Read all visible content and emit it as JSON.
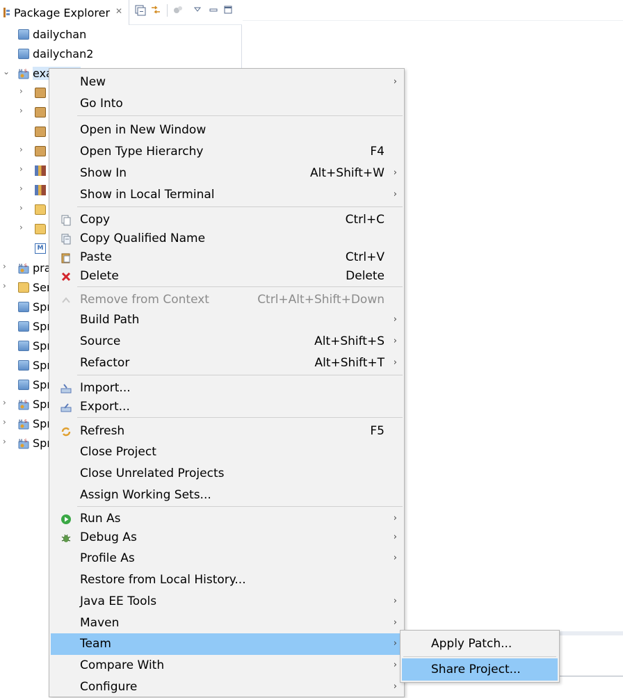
{
  "explorer": {
    "tab_title": "Package Explorer",
    "tab_close": "✕",
    "tree": [
      {
        "label": "dailychan",
        "chevron": ""
      },
      {
        "label": "dailychan2",
        "chevron": ""
      },
      {
        "label": "exa",
        "chevron": "⌄"
      },
      {
        "label": "",
        "chevron": "›"
      },
      {
        "label": "",
        "chevron": "›"
      },
      {
        "label": "",
        "chevron": ""
      },
      {
        "label": "",
        "chevron": "›"
      },
      {
        "label": "",
        "chevron": "›"
      },
      {
        "label": "",
        "chevron": "›"
      },
      {
        "label": "",
        "chevron": "›"
      },
      {
        "label": "",
        "chevron": "›"
      },
      {
        "label": "",
        "chevron": ""
      },
      {
        "label": "pra",
        "chevron": "›"
      },
      {
        "label": "Ser",
        "chevron": "›"
      },
      {
        "label": "Spr",
        "chevron": ""
      },
      {
        "label": "Spr",
        "chevron": ""
      },
      {
        "label": "Spr",
        "chevron": ""
      },
      {
        "label": "Spr",
        "chevron": ""
      },
      {
        "label": "Spr",
        "chevron": ""
      },
      {
        "label": "Spr",
        "chevron": "›"
      },
      {
        "label": "Spr",
        "chevron": "›"
      },
      {
        "label": "Spr",
        "chevron": "›"
      }
    ]
  },
  "menu": {
    "items": [
      {
        "label": "New",
        "accel": "",
        "arrow": "›"
      },
      {
        "label": "Go Into",
        "accel": "",
        "arrow": ""
      },
      {
        "label": "Open in New Window",
        "accel": "",
        "arrow": ""
      },
      {
        "label": "Open Type Hierarchy",
        "accel": "F4",
        "arrow": ""
      },
      {
        "label": "Show In",
        "accel": "Alt+Shift+W",
        "arrow": "›"
      },
      {
        "label": "Show in Local Terminal",
        "accel": "",
        "arrow": "›"
      },
      {
        "label": "Copy",
        "accel": "Ctrl+C",
        "arrow": ""
      },
      {
        "label": "Copy Qualified Name",
        "accel": "",
        "arrow": ""
      },
      {
        "label": "Paste",
        "accel": "Ctrl+V",
        "arrow": ""
      },
      {
        "label": "Delete",
        "accel": "Delete",
        "arrow": ""
      },
      {
        "label": "Remove from Context",
        "accel": "Ctrl+Alt+Shift+Down",
        "arrow": ""
      },
      {
        "label": "Build Path",
        "accel": "",
        "arrow": "›"
      },
      {
        "label": "Source",
        "accel": "Alt+Shift+S",
        "arrow": "›"
      },
      {
        "label": "Refactor",
        "accel": "Alt+Shift+T",
        "arrow": "›"
      },
      {
        "label": "Import...",
        "accel": "",
        "arrow": ""
      },
      {
        "label": "Export...",
        "accel": "",
        "arrow": ""
      },
      {
        "label": "Refresh",
        "accel": "F5",
        "arrow": ""
      },
      {
        "label": "Close Project",
        "accel": "",
        "arrow": ""
      },
      {
        "label": "Close Unrelated Projects",
        "accel": "",
        "arrow": ""
      },
      {
        "label": "Assign Working Sets...",
        "accel": "",
        "arrow": ""
      },
      {
        "label": "Run As",
        "accel": "",
        "arrow": "›"
      },
      {
        "label": "Debug As",
        "accel": "",
        "arrow": "›"
      },
      {
        "label": "Profile As",
        "accel": "",
        "arrow": "›"
      },
      {
        "label": "Restore from Local History...",
        "accel": "",
        "arrow": ""
      },
      {
        "label": "Java EE Tools",
        "accel": "",
        "arrow": "›"
      },
      {
        "label": "Maven",
        "accel": "",
        "arrow": "›"
      },
      {
        "label": "Team",
        "accel": "",
        "arrow": "›"
      },
      {
        "label": "Compare With",
        "accel": "",
        "arrow": "›"
      },
      {
        "label": "Configure",
        "accel": "",
        "arrow": "›"
      }
    ],
    "icons": {
      "copy": "copy-icon",
      "copy_qualified": "copy-qualified-name-icon",
      "paste": "paste-icon",
      "delete": "delete-icon",
      "remove_context": "remove-from-context-icon",
      "import": "import-icon",
      "export": "export-icon",
      "refresh": "refresh-icon",
      "run": "run-icon",
      "debug": "debug-icon"
    }
  },
  "submenu": {
    "items": [
      {
        "label": "Apply Patch..."
      },
      {
        "label": "Share Project..."
      }
    ]
  },
  "colors": {
    "selection": "#91c9f7",
    "menu_bg": "#f2f2f2",
    "disabled_text": "#8c8c8c"
  }
}
